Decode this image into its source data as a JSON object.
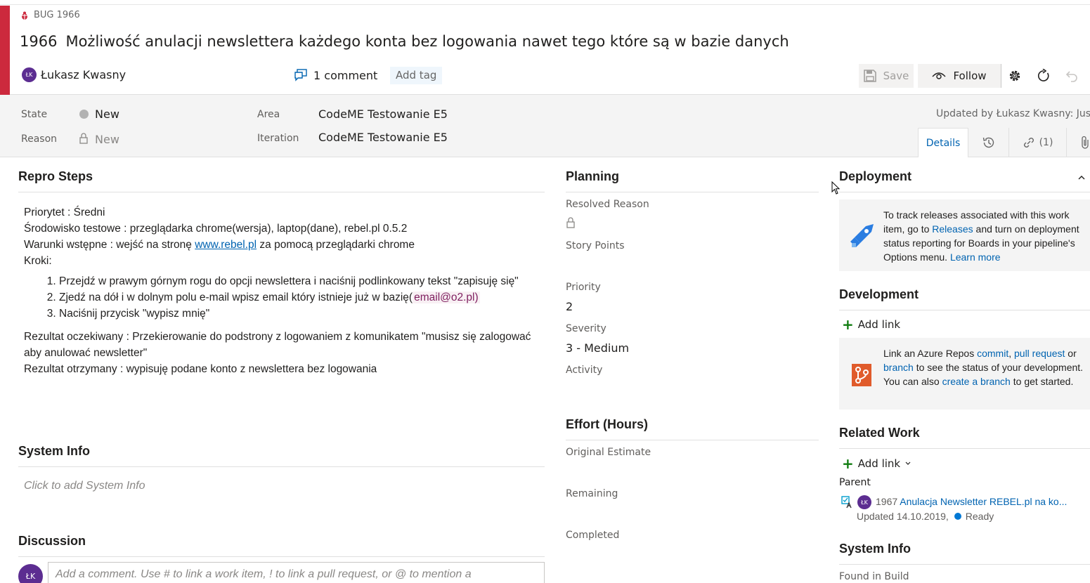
{
  "work_item": {
    "type_label": "BUG 1966",
    "id": "1966",
    "title": "Możliwość anulacji newslettera każdego konta bez logowania nawet tego które są w bazie danych",
    "author_initials": "ŁK",
    "author": "Łukasz Kwasny",
    "comment_count": "1 comment",
    "add_tag": "Add tag",
    "type_color": "#cc293d"
  },
  "toolbar": {
    "save": "Save",
    "follow": "Follow"
  },
  "fields": {
    "state_label": "State",
    "state_value": "New",
    "reason_label": "Reason",
    "reason_value": "New",
    "area_label": "Area",
    "area_value": "CodeME Testowanie E5",
    "iteration_label": "Iteration",
    "iteration_value": "CodeME Testowanie E5",
    "updated_by": "Updated by Łukasz Kwasny: Just n"
  },
  "tabs": {
    "details": "Details",
    "links": "(1)"
  },
  "repro": {
    "title": "Repro Steps",
    "line1": "Priorytet : Średni",
    "line2": "Środowisko testowe : przeglądarka chrome(wersja), laptop(dane), rebel.pl 0.5.2",
    "line3_pre": "Warunki wstępne : wejść na stronę ",
    "line3_link": "www.rebel.pl",
    "line3_post": " za pomocą przeglądarki chrome",
    "line4": "Kroki:",
    "step1": "Przejdź w prawym górnym rogu do opcji newslettera i naciśnij podlinkowany tekst \"zapisuję się\"",
    "step2_pre": "Zjedź na dół i w dolnym polu e-mail wpisz email który istnieje już w bazię(",
    "step2_mention": "email@o2.pl)",
    "step3": "Naciśnij przycisk \"wypisz mnię\"",
    "expected": "Rezultat oczekiwany : Przekierowanie do podstrony z logowaniem z komunikatem \"musisz się zalogować aby anulować newsletter\"",
    "actual": "Rezultat otrzymany : wypisuję podane konto z newslettera bez logowania"
  },
  "system_info": {
    "title": "System Info",
    "placeholder": "Click to add System Info"
  },
  "discussion": {
    "title": "Discussion",
    "avatar": "ŁK",
    "placeholder": "Add a comment. Use # to link a work item, ! to link a pull request, or @ to mention a"
  },
  "planning": {
    "title": "Planning",
    "resolved_reason": "Resolved Reason",
    "story_points": "Story Points",
    "priority_label": "Priority",
    "priority_value": "2",
    "severity_label": "Severity",
    "severity_value": "3 - Medium",
    "activity": "Activity"
  },
  "effort": {
    "title": "Effort (Hours)",
    "original": "Original Estimate",
    "remaining": "Remaining",
    "completed": "Completed"
  },
  "deployment": {
    "title": "Deployment",
    "text_a": "To track releases associated with this work item, go to ",
    "releases": "Releases",
    "text_b": " and turn on deployment status reporting for Boards in your pipeline's Options menu. ",
    "learn_more": "Learn more"
  },
  "development": {
    "title": "Development",
    "add_link": "Add link",
    "text_a": "Link an Azure Repos ",
    "commit": "commit",
    "comma": ", ",
    "pull_request": "pull request",
    "text_b": " or ",
    "branch": "branch",
    "text_c": " to see the status of your development. You can also ",
    "create_branch": "create a branch",
    "text_d": " to get started."
  },
  "related_work": {
    "title": "Related Work",
    "add_link": "Add link",
    "parent_label": "Parent",
    "parent_avatar": "ŁK",
    "parent_id": "1967 ",
    "parent_title": "Anulacja Newsletter REBEL.pl na ko...",
    "parent_updated": "Updated 14.10.2019,",
    "parent_state": "Ready"
  },
  "system_info_right": {
    "title": "System Info",
    "found_in_build": "Found in Build"
  }
}
